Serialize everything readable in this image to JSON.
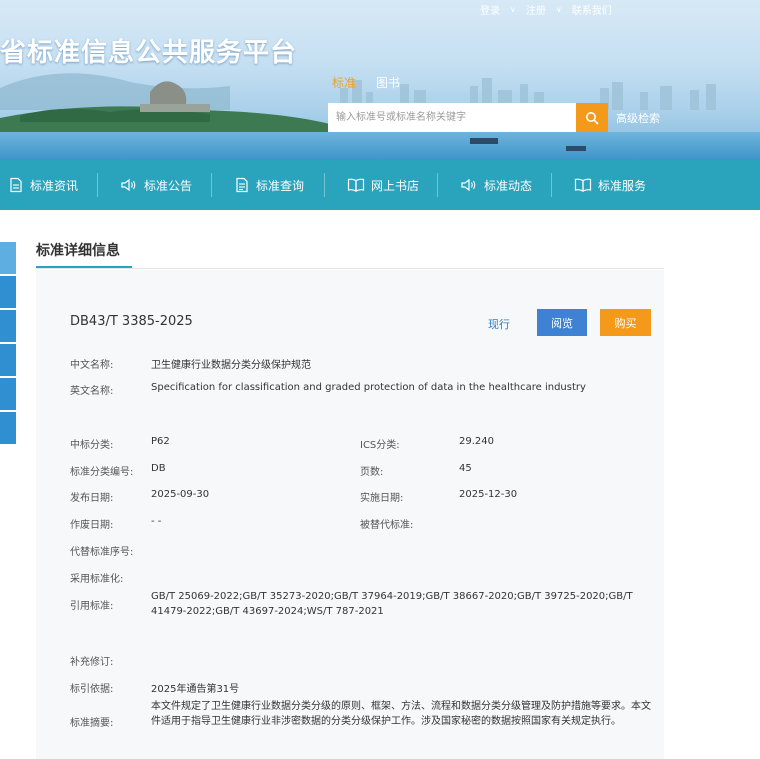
{
  "top_links": {
    "login": "登录",
    "register": "注册",
    "contact": "联系我们"
  },
  "site_title": "省标准信息公共服务平台",
  "search": {
    "tabs": [
      "标准",
      "图书"
    ],
    "placeholder": "输入标准号或标准名称关键字",
    "advanced": "高级检索"
  },
  "nav": {
    "items": [
      {
        "label": "标准资讯",
        "icon": "document-icon"
      },
      {
        "label": "标准公告",
        "icon": "speaker-icon"
      },
      {
        "label": "标准查询",
        "icon": "query-document-icon"
      },
      {
        "label": "网上书店",
        "icon": "book-icon"
      },
      {
        "label": "标准动态",
        "icon": "speaker-icon"
      },
      {
        "label": "标准服务",
        "icon": "book-icon"
      }
    ]
  },
  "section_title": "标准详细信息",
  "detail": {
    "code": "DB43/T 3385-2025",
    "status": "现行",
    "view_label": "阅览",
    "buy_label": "购买",
    "cn_name_label": "中文名称:",
    "cn_name": "卫生健康行业数据分类分级保护规范",
    "en_name_label": "英文名称:",
    "en_name": "Specification for classification and graded protection of data in the healthcare industry",
    "ccs_label": "中标分类:",
    "ccs": "P62",
    "ics_label": "ICS分类:",
    "ics": "29.240",
    "std_class_label": "标准分类编号:",
    "std_class": "DB",
    "pages_label": "页数:",
    "pages": "45",
    "publish_label": "发布日期:",
    "publish": "2025-09-30",
    "implement_label": "实施日期:",
    "implement": "2025-12-30",
    "void_label": "作废日期:",
    "void": "- -",
    "replaced_by_label": "被替代标准:",
    "replaces_label": "代替标准序号:",
    "adopt_label": "采用标准化:",
    "cited_label": "引用标准:",
    "cited": "GB/T 25069-2022;GB/T 35273-2020;GB/T 37964-2019;GB/T 38667-2020;GB/T 39725-2020;GB/T 41479-2022;GB/T 43697-2024;WS/T 787-2021",
    "amend_label": "补充修订:",
    "basis_label": "标引依据:",
    "basis": "2025年通告第31号",
    "abstract_label": "标准摘要:",
    "abstract": "本文件规定了卫生健康行业数据分类分级的原则、框架、方法、流程和数据分类分级管理及防护措施等要求。本文件适用于指导卫生健康行业非涉密数据的分类分级保护工作。涉及国家秘密的数据按照国家有关规定执行。"
  }
}
